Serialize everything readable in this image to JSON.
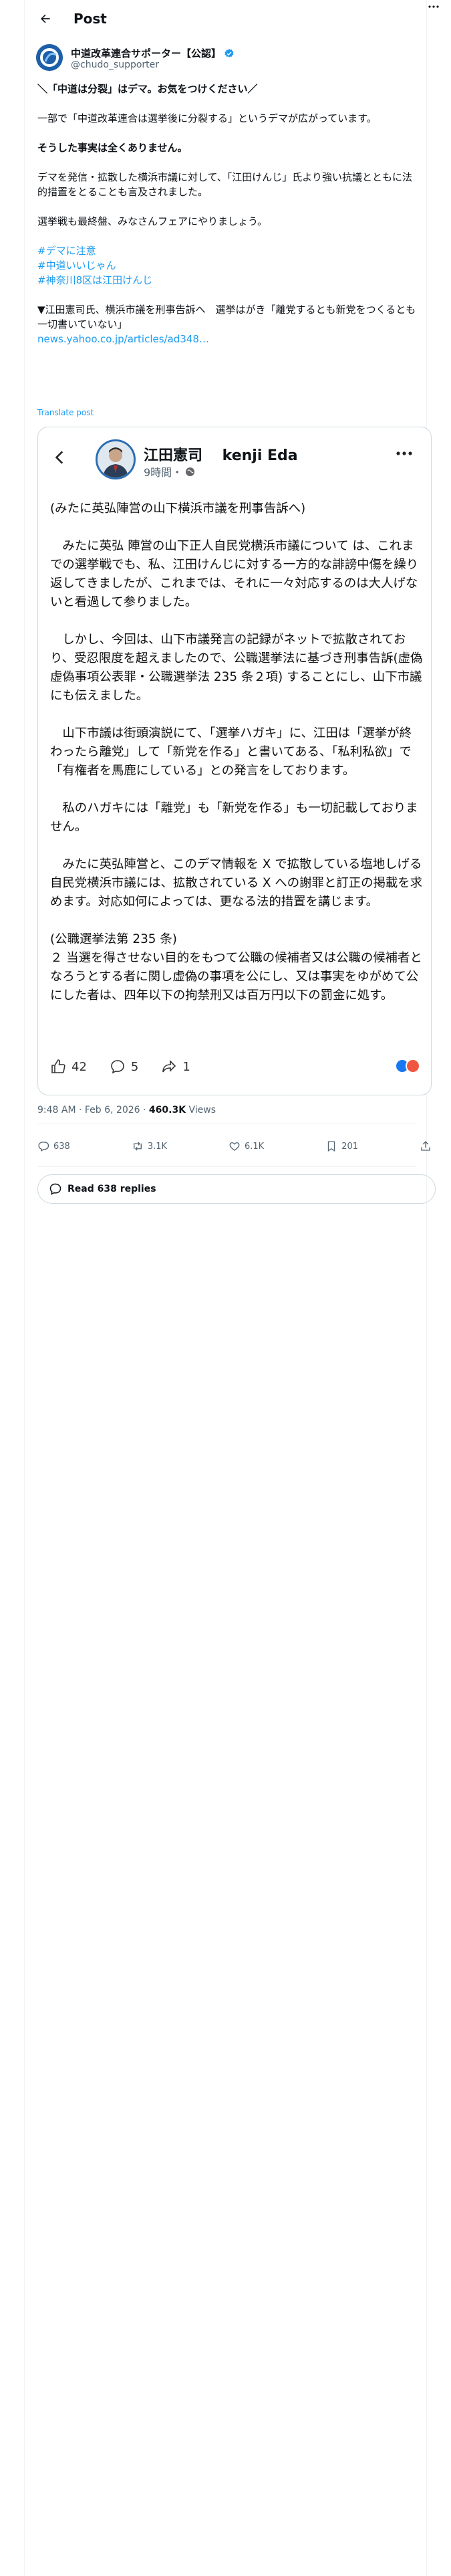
{
  "header": {
    "title": "Post"
  },
  "author": {
    "name": "中道改革連合サポーター【公認】",
    "handle": "@chudo_supporter"
  },
  "tweet": {
    "line1": "＼「中道は分裂」はデマ。お気をつけください／",
    "line2": "一部で「中道改革連合は選挙後に分裂する」というデマが広がっています。",
    "line3": "そうした事実は全くありません。",
    "line4": "デマを発信・拡散した横浜市議に対して、「江田けんじ」氏より強い抗議とともに法的措置をとることも言及されました。",
    "line5": "選挙戦も最終盤、みなさんフェアにやりましょう。",
    "hashtags": [
      "#デマに注意",
      "#中道いいじゃん",
      "#神奈川8区は江田けんじ"
    ],
    "line6": "▼江田憲司氏、横浜市議を刑事告訴へ　選挙はがき「離党するとも新党をつくるとも一切書いていない」",
    "link": "news.yahoo.co.jp/articles/ad348…",
    "translate": "Translate post"
  },
  "card": {
    "name": "江田憲司　 kenji Eda",
    "time": "9時間・",
    "p1": "(みたに英弘陣営の山下横浜市議を刑事告訴へ)",
    "p2": "　みたに英弘 陣営の山下正人自民党横浜市議について は、これまでの選挙戦でも、私、江田けんじに対する一方的な誹謗中傷を繰り返してきましたが、これまでは、それに一々対応するのは大人げないと看過して参りました。",
    "p3": "　しかし、今回は、山下市議発言の記録がネットで拡散されており、受忍限度を超えましたので、公職選挙法に基づき刑事告訴(虚偽虚偽事項公表罪・公職選挙法 235 条２項) することにし、山下市議にも伝えました。",
    "p4": "　山下市議は街頭演説にて、「選挙ハガキ」に、江田は「選挙が終わったら離党」して「新党を作る」と書いてある、「私利私欲」で「有権者を馬鹿にしている」との発言をしております。",
    "p5": "　私のハガキには「離党」も「新党を作る」も一切記載しておりません。",
    "p6": "　みたに英弘陣営と、このデマ情報を X で拡散している塩地しげる自民党横浜市議には、拡散されている X への謝罪と訂正の掲載を求めます。対応如何によっては、更なる法的措置を講じます。",
    "p7": "(公職選挙法第 235 条)",
    "p8": "２ 当選を得させない目的をもつて公職の候補者又は公職の候補者となろうとする者に関し虚偽の事項を公にし、又は事実をゆがめて公にした者は、四年以下の拘禁刑又は百万円以下の罰金に処す。",
    "likes": "42",
    "comments": "5",
    "shares": "1"
  },
  "meta": {
    "time": "9:48 AM · Feb 6, 2026 · ",
    "views_count": "460.3K",
    "views_label": " Views"
  },
  "actions": {
    "replies": "638",
    "reposts": "3.1K",
    "likes": "6.1K",
    "bookmarks": "201"
  },
  "read_replies": "Read 638 replies",
  "colors": {
    "link": "#1d9bf0",
    "verified": "#1d9bf0",
    "text_secondary": "#536471"
  }
}
